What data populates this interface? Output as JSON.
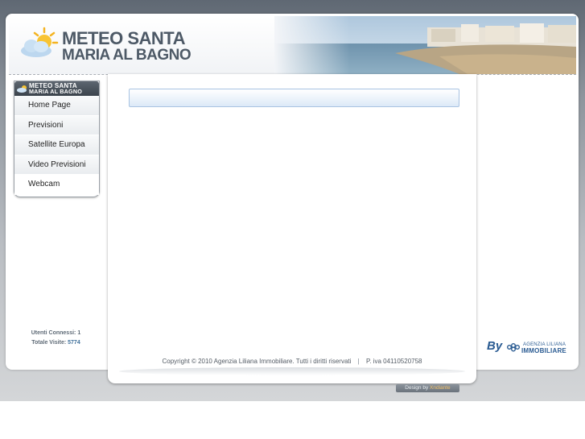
{
  "site": {
    "logo_line1": "METEO SANTA",
    "logo_line2": "MARIA AL BAGNO"
  },
  "menu": {
    "header_line1": "METEO SANTA",
    "header_line2": "MARIA AL BAGNO",
    "items": [
      {
        "label": "Home Page"
      },
      {
        "label": "Previsioni"
      },
      {
        "label": "Satellite Europa"
      },
      {
        "label": "Video Previsioni"
      },
      {
        "label": "Webcam"
      }
    ]
  },
  "stats": {
    "online_label": "Utenti Connessi:",
    "online_value": "1",
    "total_label": "Totale Visite:",
    "total_value": "5774"
  },
  "footer": {
    "copyright": "Copyright © 2010 Agenzia Liliana Immobiliare. Tutti i diritti riservati",
    "separator": "|",
    "vat": "P. iva 04110520758"
  },
  "sponsor": {
    "by": "By",
    "line1": "AGENZIA LILIANA",
    "line2": "IMMOBILIARE"
  },
  "design_credit": {
    "prefix": "Design by",
    "brand": "Xndiante"
  },
  "colors": {
    "accent_blue": "#2a5b92",
    "panel_border": "#a8c3e2",
    "text_gray": "#4d5966"
  }
}
